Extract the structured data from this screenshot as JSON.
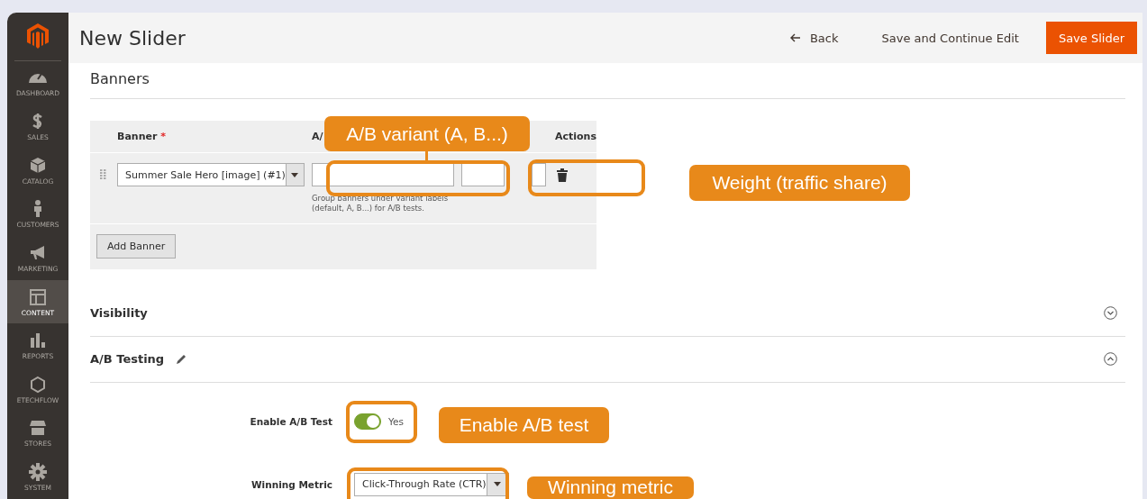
{
  "header": {
    "title": "New Slider",
    "back": "Back",
    "save_continue": "Save and Continue Edit",
    "save": "Save Slider"
  },
  "sidebar": {
    "items": [
      {
        "label": "DASHBOARD",
        "kind": "gauge",
        "selected": false
      },
      {
        "label": "SALES",
        "kind": "dollar",
        "selected": false
      },
      {
        "label": "CATALOG",
        "kind": "box",
        "selected": false
      },
      {
        "label": "CUSTOMERS",
        "kind": "person",
        "selected": false
      },
      {
        "label": "MARKETING",
        "kind": "megaphone",
        "selected": false
      },
      {
        "label": "CONTENT",
        "kind": "layout",
        "selected": true
      },
      {
        "label": "REPORTS",
        "kind": "bars",
        "selected": false
      },
      {
        "label": "ETECHFLOW",
        "kind": "hexagon",
        "selected": false
      },
      {
        "label": "STORES",
        "kind": "store",
        "selected": false
      },
      {
        "label": "SYSTEM",
        "kind": "gear",
        "selected": false
      }
    ]
  },
  "banners": {
    "title": "Banners",
    "columns": [
      {
        "label": "Banner",
        "marker": "*"
      },
      {
        "label": "A/"
      },
      {
        "label": "Actions"
      }
    ],
    "rows": [
      {
        "banner": "Summer Sale Hero [image] (#1)",
        "help": "Group banners under variant labels (default, A, B...) for A/B tests."
      }
    ],
    "add_button": "Add Banner"
  },
  "sections": [
    {
      "title": "Visibility",
      "expanded": false,
      "editable": false
    },
    {
      "title": "A/B Testing",
      "expanded": true,
      "editable": true
    }
  ],
  "ab_testing": {
    "fields": [
      {
        "kind": "toggle",
        "label": "Enable A/B Test",
        "on": true,
        "value": "Yes"
      },
      {
        "kind": "select",
        "label": "Winning Metric",
        "value": "Click-Through Rate (CTR)"
      }
    ]
  },
  "annotations": [
    {
      "kind": "callout",
      "text": "A/B variant (A, B...)"
    },
    {
      "kind": "ring"
    },
    {
      "kind": "ring"
    },
    {
      "kind": "callout",
      "text": "Weight (traffic share)"
    },
    {
      "kind": "ring"
    },
    {
      "kind": "callout",
      "text": "Enable A/B test"
    },
    {
      "kind": "ring"
    },
    {
      "kind": "callout",
      "text": "Winning metric"
    }
  ]
}
